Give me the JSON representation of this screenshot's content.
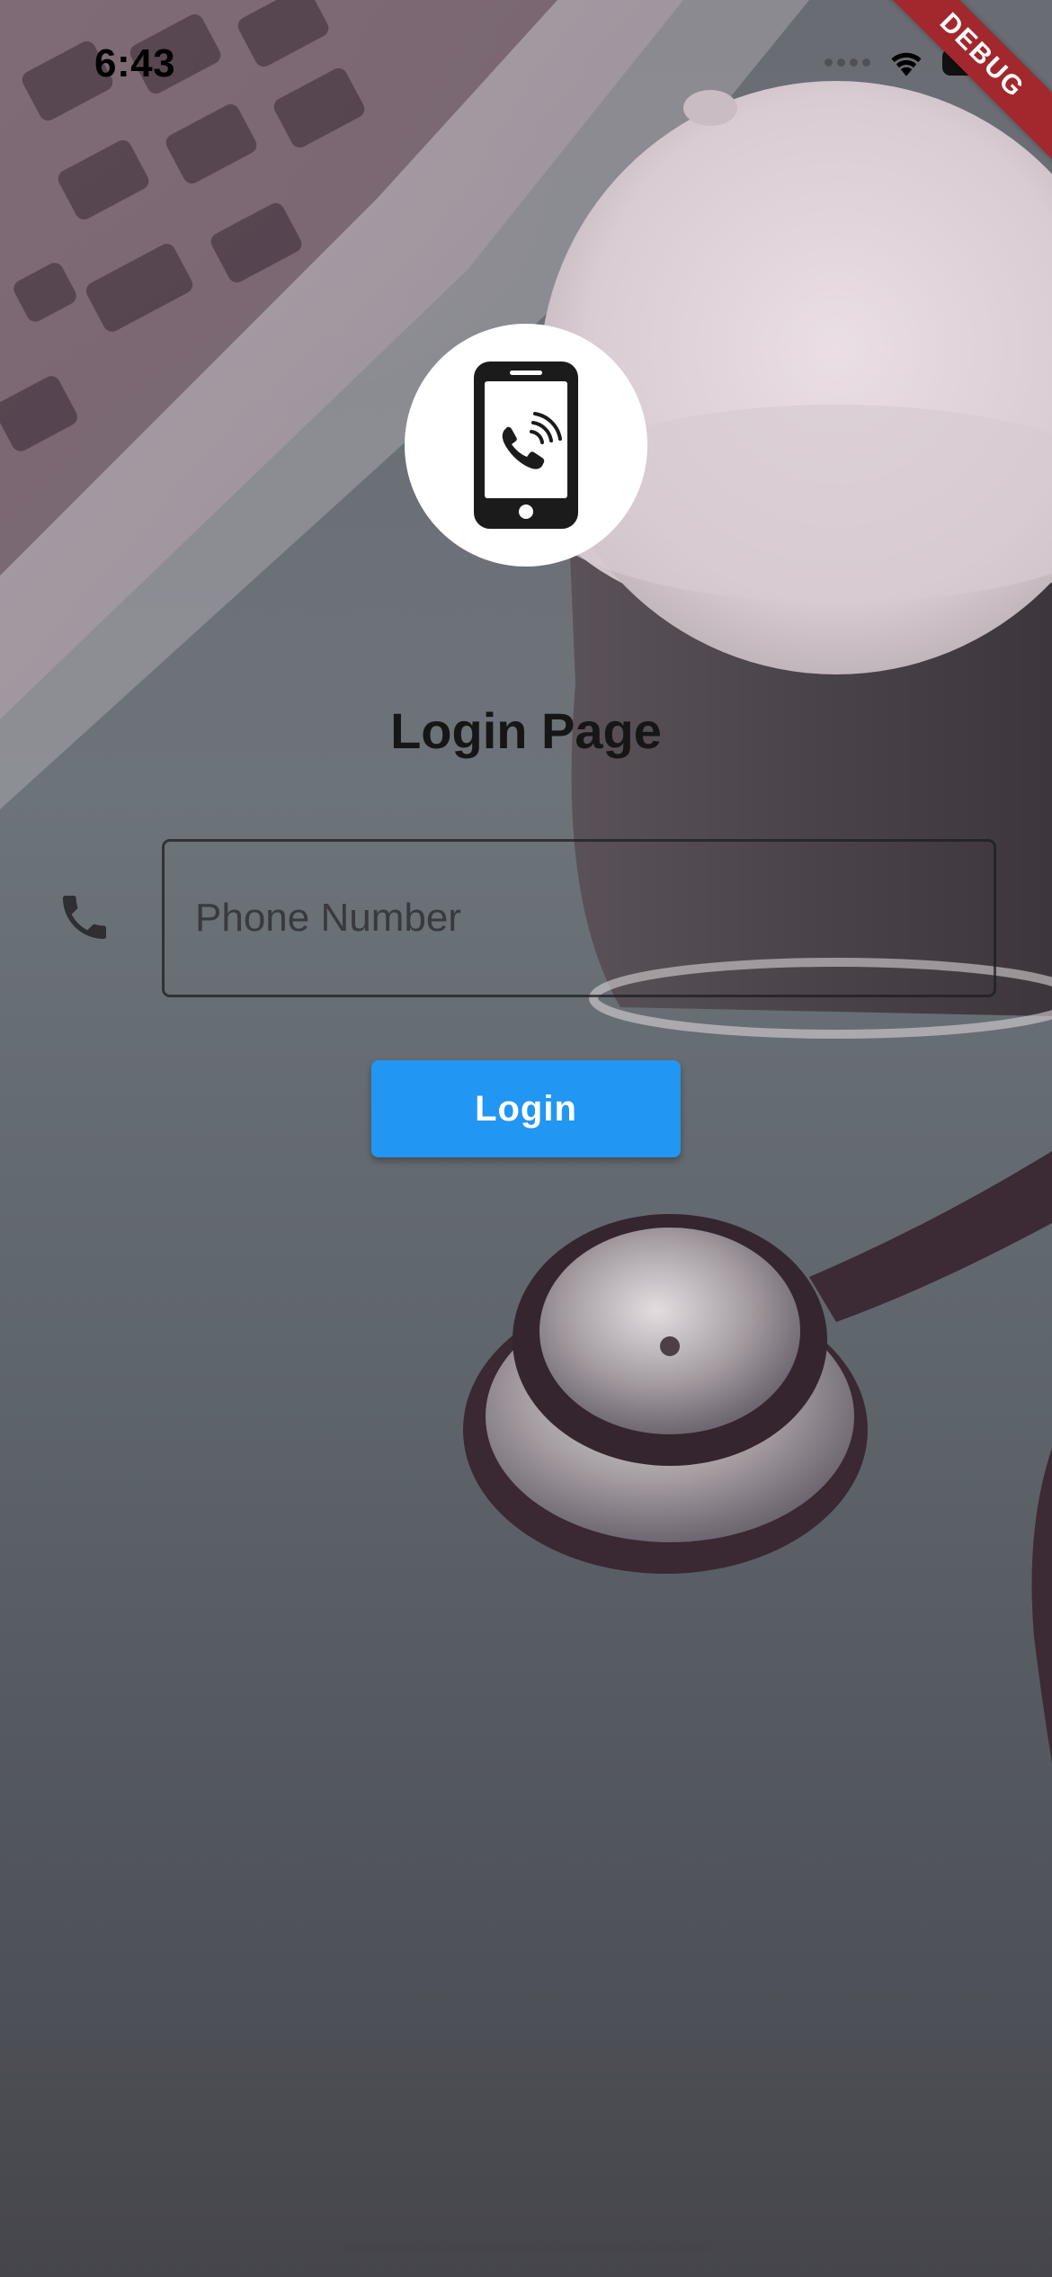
{
  "status_bar": {
    "time": "6:43",
    "wifi_icon": "wifi-icon",
    "battery_icon": "battery-icon"
  },
  "debug_banner": "DEBUG",
  "avatar": {
    "icon": "phone-call-icon",
    "background": "#ffffff"
  },
  "title": "Login Page",
  "phone_input": {
    "icon": "phone-icon",
    "placeholder": "Phone Number",
    "value": ""
  },
  "login_button": {
    "label": "Login",
    "color": "#2196f3"
  },
  "colors": {
    "primary": "#2196f3",
    "debug": "#a2282d",
    "title": "#161616"
  }
}
